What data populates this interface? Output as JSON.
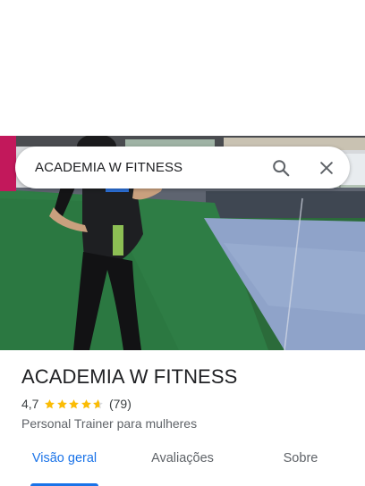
{
  "search": {
    "query": "ACADEMIA W FITNESS",
    "search_icon": "search-icon",
    "close_icon": "close-icon"
  },
  "place": {
    "title": "ACADEMIA W FITNESS",
    "rating": "4,7",
    "rating_stars": 4.7,
    "review_count": "(79)",
    "category": "Personal Trainer para mulheres"
  },
  "tabs": [
    {
      "label": "Visão geral",
      "active": true
    },
    {
      "label": "Avaliações",
      "active": false
    },
    {
      "label": "Sobre",
      "active": false
    }
  ],
  "colors": {
    "accent": "#1a73e8",
    "star": "#fbbc04",
    "turf": "#2e7d45",
    "mat": "#8fa3c9"
  }
}
